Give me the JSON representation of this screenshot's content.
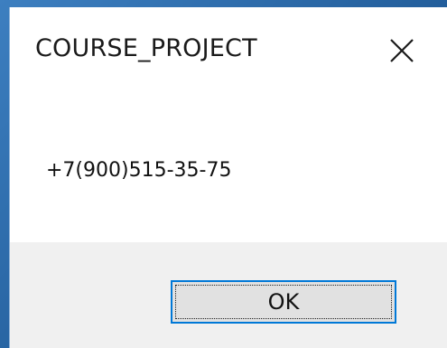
{
  "dialog": {
    "title": "COURSE_PROJECT",
    "close_icon": "close-icon",
    "message": "+7(900)515-35-75",
    "ok_label": "OK"
  },
  "colors": {
    "accent": "#0078d7",
    "footer_bg": "#f0f0f0",
    "button_bg": "#e1e1e1",
    "desktop_bg": "#2f6fae"
  }
}
